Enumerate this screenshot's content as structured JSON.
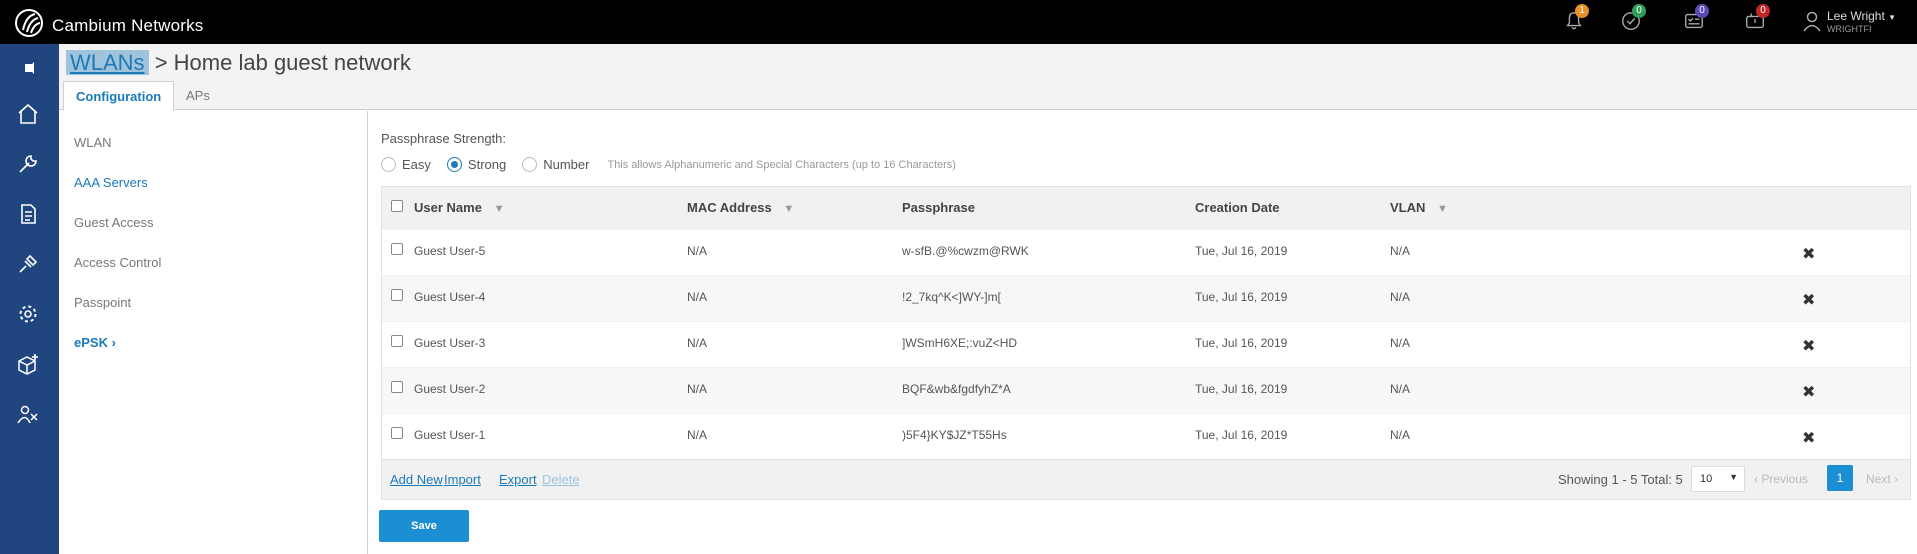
{
  "brand": {
    "name": "Cambium Networks"
  },
  "notifications": [
    {
      "icon": "bell-icon",
      "count": "1",
      "color": "#e6912c"
    },
    {
      "icon": "check-circle-icon",
      "count": "0",
      "color": "#2f9e5c"
    },
    {
      "icon": "tasks-icon",
      "count": "0",
      "color": "#5b4bb8"
    },
    {
      "icon": "device-alert-icon",
      "count": "0",
      "color": "#c22828"
    }
  ],
  "user": {
    "name": "Lee Wright",
    "org": "WRIGHTFI"
  },
  "leftnav": [
    "pin-icon",
    "home-icon",
    "wrench-icon",
    "report-icon",
    "tools-icon",
    "gear-icon",
    "box-plus-icon",
    "users-icon"
  ],
  "breadcrumb": {
    "link": "WLANs",
    "separator": ">",
    "title": "Home lab guest network"
  },
  "tabs": {
    "active": "Configuration",
    "inactive": "APs"
  },
  "sidemenu": [
    "WLAN",
    "AAA Servers",
    "Guest Access",
    "Access Control",
    "Passpoint",
    "ePSK ›"
  ],
  "passphrase": {
    "label": "Passphrase Strength:",
    "options": [
      "Easy",
      "Strong",
      "Number"
    ],
    "selected": "Strong",
    "note": "This allows Alphanumeric and Special Characters (up to 16 Characters)"
  },
  "table": {
    "columns": [
      "User Name",
      "MAC Address",
      "Passphrase",
      "Creation Date",
      "VLAN"
    ],
    "rows": [
      [
        "Guest User-5",
        "N/A",
        "w-sfB.@%cwzm@RWK",
        "Tue, Jul 16, 2019",
        "N/A"
      ],
      [
        "Guest User-4",
        "N/A",
        "!2_7kq^K<]WY-]m[",
        "Tue, Jul 16, 2019",
        "N/A"
      ],
      [
        "Guest User-3",
        "N/A",
        "]WSmH6XE;:vuZ<HD",
        "Tue, Jul 16, 2019",
        "N/A"
      ],
      [
        "Guest User-2",
        "N/A",
        "BQF&wb&fgdfyhZ*A",
        "Tue, Jul 16, 2019",
        "N/A"
      ],
      [
        "Guest User-1",
        "N/A",
        ")5F4}KY$JZ*T55Hs",
        "Tue, Jul 16, 2019",
        "N/A"
      ]
    ]
  },
  "footer": {
    "add_new": "Add New",
    "import": "Import",
    "export": "Export",
    "delete": "Delete",
    "showing": "Showing 1 - 5 Total: 5",
    "page_size": "10",
    "previous": "‹ Previous",
    "current_page": "1",
    "next": "Next ›"
  },
  "save_label": "Save"
}
